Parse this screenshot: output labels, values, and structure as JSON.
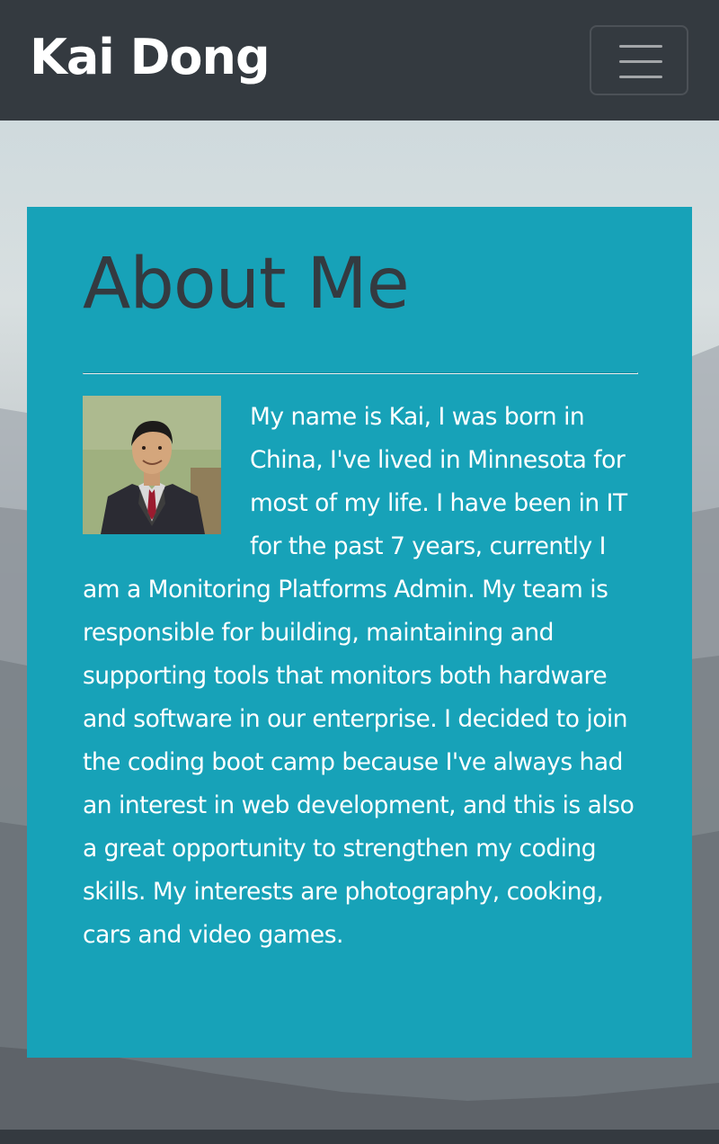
{
  "navbar": {
    "brand": "Kai Dong",
    "toggle_icon": "hamburger-menu-icon"
  },
  "about": {
    "title": "About Me",
    "bio": "My name is Kai, I was born in China, I've lived in Minnesota for most of my life. I have been in IT for the past 7 years, currently I am a Monitoring Platforms Admin. My team is responsible for building, maintaining and supporting tools that monitors both hardware and software in our enterprise. I decided to join the coding boot camp because I've always had an interest in web development, and this is also a great opportunity to strengthen my coding skills. My interests are photography, cooking, cars and video games."
  },
  "colors": {
    "navbar": "#343a40",
    "card": "#17a2b8",
    "title": "#343a40",
    "text": "#ffffff"
  }
}
